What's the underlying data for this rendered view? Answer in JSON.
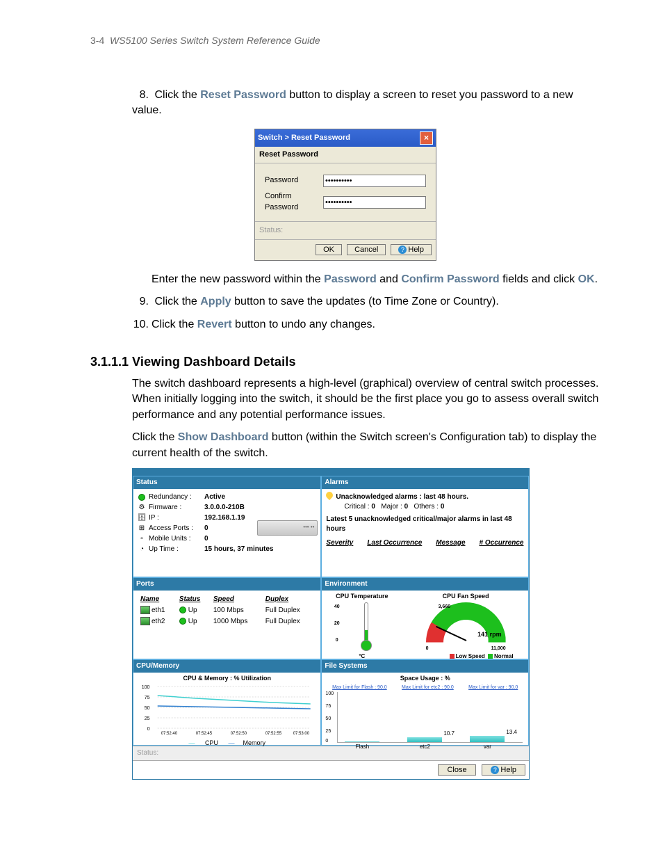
{
  "header": {
    "pageNum": "3-4",
    "title": "WS5100 Series Switch System Reference Guide"
  },
  "steps_a": {
    "s8": {
      "n": "8.",
      "pre": "Click the ",
      "btn": "Reset Password",
      "post": " button to display a screen to reset you password to a new value."
    }
  },
  "dialog": {
    "title": "Switch > Reset Password",
    "subtitle": "Reset Password",
    "pw_label": "Password",
    "pw_val": "**********",
    "cpw_label": "Confirm Password",
    "cpw_val": "**********",
    "status": "Status:",
    "ok": "OK",
    "cancel": "Cancel",
    "help": "Help"
  },
  "after_dialog": {
    "line1_pre": "Enter the new password within the ",
    "line1_b1": "Password",
    "line1_mid": " and ",
    "line1_b2": "Confirm Password",
    "line1_mid2": " fields and click ",
    "line1_b3": "OK",
    "line1_end": ".",
    "s9": {
      "n": "9.",
      "pre": "Click the ",
      "btn": "Apply",
      "post": " button to save the updates (to Time Zone or Country)."
    },
    "s10": {
      "n": "10.",
      "pre": "Click the ",
      "btn": "Revert",
      "post": " button to undo any changes."
    }
  },
  "section": {
    "num": "3.1.1.1",
    "title": "Viewing Dashboard Details"
  },
  "para1": "The switch dashboard represents a high-level (graphical) overview of central switch processes. When initially logging into the switch, it should be the first place you go to assess overall switch performance and any potential performance issues.",
  "para2_pre": "Click the ",
  "para2_btn": "Show Dashboard",
  "para2_post": " button (within the Switch screen's Configuration tab) to display the current health of the switch.",
  "dash": {
    "status": {
      "h": "Status",
      "rows": [
        {
          "ico": "dot-green",
          "label": "Redundancy :",
          "val": "Active"
        },
        {
          "ico": "gears",
          "label": "Firmware :",
          "val": "3.0.0.0-210B"
        },
        {
          "ico": "cyl",
          "label": "IP :",
          "val": "192.168.1.19"
        },
        {
          "ico": "net",
          "label": "Access Ports :",
          "val": "0"
        },
        {
          "ico": "mu",
          "label": "Mobile Units :",
          "val": "0"
        },
        {
          "ico": "clock",
          "label": "Up Time :",
          "val": "15 hours, 37 minutes"
        }
      ]
    },
    "alarms": {
      "h": "Alarms",
      "line1": "Unacknowledged alarms : last 48 hours.",
      "line2_a": "Critical :",
      "line2_av": "0",
      "line2_b": "Major :",
      "line2_bv": "0",
      "line2_c": "Others :",
      "line2_cv": "0",
      "line3": "Latest 5 unacknowledged critical/major alarms in last 48 hours",
      "cols": [
        "Severity",
        "Last Occurrence",
        "Message",
        "# Occurrence"
      ]
    },
    "ports": {
      "h": "Ports",
      "cols": [
        "Name",
        "Status",
        "Speed",
        "Duplex"
      ],
      "rows": [
        {
          "name": "eth1",
          "status": "Up",
          "speed": "100 Mbps",
          "duplex": "Full Duplex"
        },
        {
          "name": "eth2",
          "status": "Up",
          "speed": "1000 Mbps",
          "duplex": "Full Duplex"
        }
      ]
    },
    "env": {
      "h": "Environment",
      "temp_h": "CPU Temperature",
      "temp_unit": "°C",
      "temp_scale": [
        "40",
        "20",
        "0"
      ],
      "temp_val": "20",
      "fan_h": "CPU Fan Speed",
      "fan_val": "141 rpm",
      "fan_min": "0",
      "fan_max": "11,000",
      "fan_low": "3,660",
      "leg_low": "Low Speed",
      "leg_norm": "Normal"
    },
    "cpu": {
      "h": "CPU/Memory",
      "title": "CPU & Memory : % Utilization",
      "y": [
        "100",
        "75",
        "50",
        "25",
        "0"
      ],
      "x": [
        "07:52:40",
        "07:52:45",
        "07:52:50",
        "07:52:55",
        "07:53:00"
      ],
      "leg_cpu": "CPU",
      "leg_mem": "Memory"
    },
    "fs": {
      "h": "File Systems",
      "title": "Space Usage : %",
      "limits": [
        "Max Limit for Flash : 90.0",
        "Max Limit for etc2 : 90.0",
        "Max Limit for var : 90.0"
      ],
      "y": [
        "100",
        "75",
        "50",
        "25",
        "0"
      ],
      "bars": [
        {
          "name": "Flash",
          "val": "",
          "h": 2
        },
        {
          "name": "etc2",
          "val": "10.7",
          "h": 10.7
        },
        {
          "name": "var",
          "val": "13.4",
          "h": 13.4
        }
      ]
    },
    "statusbar": "Status:",
    "close": "Close",
    "help": "Help"
  },
  "chart_data": [
    {
      "type": "line",
      "title": "CPU & Memory : % Utilization",
      "x": [
        "07:52:40",
        "07:52:45",
        "07:52:50",
        "07:52:55",
        "07:53:00"
      ],
      "series": [
        {
          "name": "CPU",
          "values": [
            78,
            72,
            68,
            62,
            58
          ]
        },
        {
          "name": "Memory",
          "values": [
            53,
            52,
            50,
            48,
            46
          ]
        }
      ],
      "ylabel": "% Utilization",
      "ylim": [
        0,
        100
      ]
    },
    {
      "type": "bar",
      "title": "Space Usage : %",
      "categories": [
        "Flash",
        "etc2",
        "var"
      ],
      "values": [
        2,
        10.7,
        13.4
      ],
      "ylim": [
        0,
        100
      ]
    },
    {
      "type": "gauge",
      "title": "CPU Fan Speed",
      "value": 141,
      "unit": "rpm",
      "min": 0,
      "max": 11000,
      "zones": [
        {
          "name": "Low Speed",
          "max": 3660,
          "color": "#e03030"
        },
        {
          "name": "Normal",
          "max": 11000,
          "color": "#1dbf1d"
        }
      ]
    },
    {
      "type": "gauge",
      "title": "CPU Temperature",
      "value": 20,
      "unit": "°C",
      "min": 0,
      "max": 40
    }
  ]
}
